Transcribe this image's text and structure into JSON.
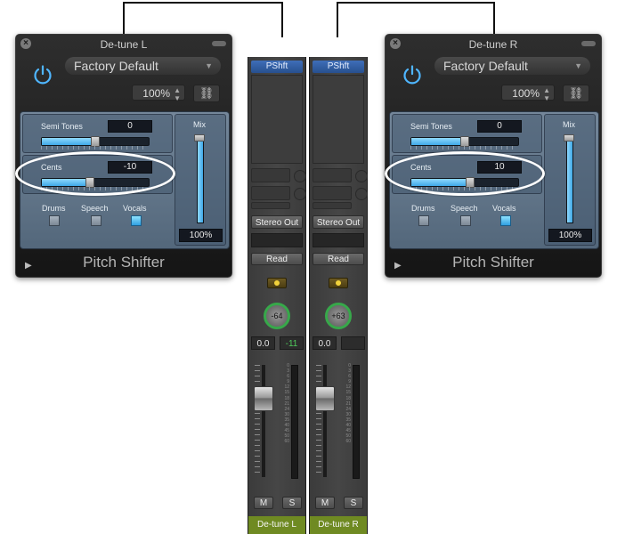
{
  "plugins": [
    {
      "title": "De-tune L",
      "preset": "Factory Default",
      "zoom": "100%",
      "semitones_label": "Semi Tones",
      "semitones_value": "0",
      "semitones_level": 0.5,
      "cents_label": "Cents",
      "cents_value": "-10",
      "cents_level": 0.45,
      "drums_label": "Drums",
      "speech_label": "Speech",
      "vocals_label": "Vocals",
      "mix_label": "Mix",
      "mix_value": "100%",
      "name": "Pitch Shifter"
    },
    {
      "title": "De-tune R",
      "preset": "Factory Default",
      "zoom": "100%",
      "semitones_label": "Semi Tones",
      "semitones_value": "0",
      "semitones_level": 0.5,
      "cents_label": "Cents",
      "cents_value": "10",
      "cents_level": 0.55,
      "drums_label": "Drums",
      "speech_label": "Speech",
      "vocals_label": "Vocals",
      "mix_label": "Mix",
      "mix_value": "100%",
      "name": "Pitch Shifter"
    }
  ],
  "channels": [
    {
      "insert": "PShft",
      "output": "Stereo Out",
      "automation": "Read",
      "pan": "-64",
      "volume": "0.0",
      "peak": "-11",
      "mute": "M",
      "solo": "S",
      "name": "De-tune L"
    },
    {
      "insert": "PShft",
      "output": "Stereo Out",
      "automation": "Read",
      "pan": "+63",
      "volume": "0.0",
      "peak": "",
      "mute": "M",
      "solo": "S",
      "name": "De-tune R"
    }
  ],
  "db_scale": [
    "0",
    "3",
    "6",
    "9",
    "12",
    "15",
    "18",
    "21",
    "24",
    "30",
    "35",
    "40",
    "45",
    "50",
    "60"
  ],
  "colors": {
    "accent": "#3fa8e6",
    "track": "#6f8a22",
    "pan_ring": "#37a84a"
  }
}
